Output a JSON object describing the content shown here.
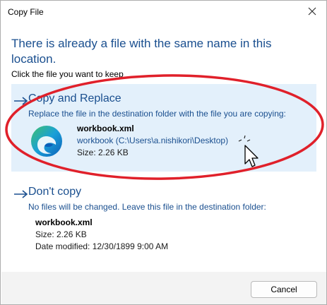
{
  "window": {
    "title": "Copy File"
  },
  "heading": "There is already a file with the same name in this location.",
  "instruction": "Click the file you want to keep",
  "options": [
    {
      "title": "Copy and Replace",
      "description": "Replace the file in the destination folder with the file you are copying:",
      "file": {
        "name": "workbook.xml",
        "path": "workbook (C:\\Users\\a.nishikori\\Desktop)",
        "size": "Size: 2.26 KB"
      },
      "icon": "edge-browser-icon"
    },
    {
      "title": "Don't copy",
      "description": "No files will be changed. Leave this file in the destination folder:",
      "file": {
        "name": "workbook.xml",
        "size": "Size: 2.26 KB",
        "date": "Date modified: 12/30/1899 9:00 AM"
      }
    }
  ],
  "buttons": {
    "cancel": "Cancel"
  },
  "colors": {
    "accent": "#1a4f8f",
    "highlight": "#e3f0fb",
    "annotation": "#e0202a"
  }
}
